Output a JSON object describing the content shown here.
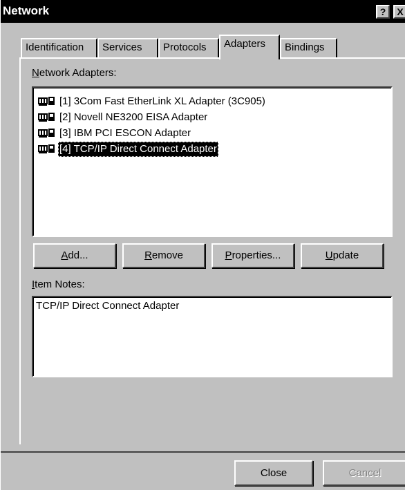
{
  "window": {
    "title": "Network",
    "help_button": "?",
    "close_button": "X"
  },
  "tabs": [
    {
      "label": "Identification",
      "active": false
    },
    {
      "label": "Services",
      "active": false
    },
    {
      "label": "Protocols",
      "active": false
    },
    {
      "label": "Adapters",
      "active": true
    },
    {
      "label": "Bindings",
      "active": false
    }
  ],
  "adapters_panel": {
    "list_label": "Network Adapters:",
    "list_label_underline": "N",
    "adapters": [
      {
        "text": "[1] 3Com Fast EtherLink XL Adapter (3C905)",
        "icon": "network-card-icon",
        "selected": false
      },
      {
        "text": "[2] Novell NE3200 EISA Adapter",
        "icon": "network-card-icon",
        "selected": false
      },
      {
        "text": "[3] IBM PCI ESCON Adapter",
        "icon": "network-card-icon",
        "selected": false
      },
      {
        "text": "[4] TCP/IP Direct Connect Adapter",
        "icon": "network-card-icon",
        "selected": true
      }
    ],
    "buttons": {
      "add": "Add...",
      "remove": "Remove",
      "properties": "Properties...",
      "update": "Update"
    },
    "notes_label": "Item Notes:",
    "notes_text": "TCP/IP Direct Connect Adapter"
  },
  "footer": {
    "close": "Close",
    "cancel": "Cancel"
  }
}
